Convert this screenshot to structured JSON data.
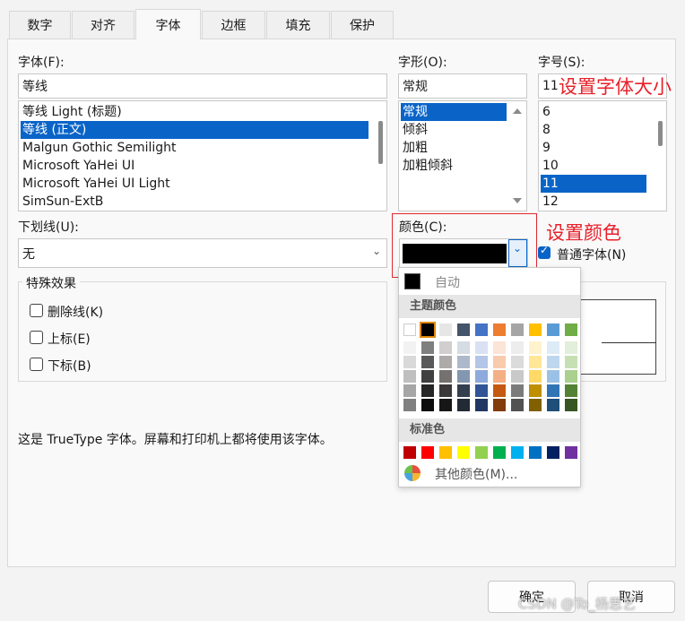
{
  "tabs": [
    {
      "label": "数字"
    },
    {
      "label": "对齐"
    },
    {
      "label": "字体"
    },
    {
      "label": "边框"
    },
    {
      "label": "填充"
    },
    {
      "label": "保护"
    }
  ],
  "font": {
    "label": "字体(F):",
    "value": "等线",
    "list": [
      {
        "label": "等线 Light (标题)"
      },
      {
        "label": "等线 (正文)"
      },
      {
        "label": "Malgun Gothic Semilight"
      },
      {
        "label": "Microsoft YaHei UI"
      },
      {
        "label": "Microsoft YaHei UI Light"
      },
      {
        "label": "SimSun-ExtB"
      }
    ],
    "selected": "等线 (正文)"
  },
  "style": {
    "label": "字形(O):",
    "value": "常规",
    "list": [
      {
        "label": "常规"
      },
      {
        "label": "倾斜"
      },
      {
        "label": "加粗"
      },
      {
        "label": "加粗倾斜"
      }
    ],
    "selected": "常规"
  },
  "size": {
    "label": "字号(S):",
    "value": "11",
    "list": [
      {
        "label": "6"
      },
      {
        "label": "8"
      },
      {
        "label": "9"
      },
      {
        "label": "10"
      },
      {
        "label": "11"
      },
      {
        "label": "12"
      }
    ],
    "selected": "11"
  },
  "underline": {
    "label": "下划线(U):",
    "value": "无"
  },
  "color": {
    "label": "颜色(C):",
    "value_color": "#000000"
  },
  "normal_font": {
    "label": "普通字体(N)",
    "checked": true
  },
  "effects": {
    "group_label": "特殊效果",
    "items": [
      {
        "label": "删除线(K)",
        "checked": false
      },
      {
        "label": "上标(E)",
        "checked": false
      },
      {
        "label": "下标(B)",
        "checked": false
      }
    ]
  },
  "info_text": "这是 TrueType 字体。屏幕和打印机上都将使用该字体。",
  "annotations": {
    "size": "设置字体大小",
    "color": "设置颜色"
  },
  "color_popup": {
    "auto_label": "自动",
    "theme_label": "主题颜色",
    "standard_label": "标准色",
    "more_label": "其他颜色(M)...",
    "theme_colors": [
      [
        "#ffffff",
        "#000000",
        "#e7e6e6",
        "#44546a",
        "#4472c4",
        "#ed7d31",
        "#a5a5a5",
        "#ffc000",
        "#5b9bd5",
        "#70ad47"
      ],
      [
        "#f2f2f2",
        "#7f7f7f",
        "#d0cece",
        "#d6dce4",
        "#d9e1f2",
        "#fce4d6",
        "#ededed",
        "#fff2cc",
        "#ddebf7",
        "#e2efda"
      ],
      [
        "#d9d9d9",
        "#595959",
        "#aeaaaa",
        "#adb9ca",
        "#b4c6e7",
        "#f8cbad",
        "#dbdbdb",
        "#ffe699",
        "#bdd7ee",
        "#c6e0b4"
      ],
      [
        "#bfbfbf",
        "#404040",
        "#757171",
        "#8497b0",
        "#8ea9db",
        "#f4b084",
        "#c9c9c9",
        "#ffd966",
        "#9bc2e6",
        "#a9d08e"
      ],
      [
        "#a6a6a6",
        "#262626",
        "#3a3838",
        "#333f4f",
        "#305496",
        "#c65911",
        "#7b7b7b",
        "#bf8f00",
        "#2f75b5",
        "#548235"
      ],
      [
        "#808080",
        "#0d0d0d",
        "#161616",
        "#222b35",
        "#203764",
        "#833c0c",
        "#525252",
        "#806000",
        "#1f4e78",
        "#375623"
      ]
    ],
    "standard_colors": [
      "#c00000",
      "#ff0000",
      "#ffc000",
      "#ffff00",
      "#92d050",
      "#00b050",
      "#00b0f0",
      "#0070c0",
      "#002060",
      "#7030a0"
    ]
  },
  "buttons": {
    "ok": "确定",
    "cancel": "取消"
  },
  "watermark": "CSDN @To_杨思艺"
}
